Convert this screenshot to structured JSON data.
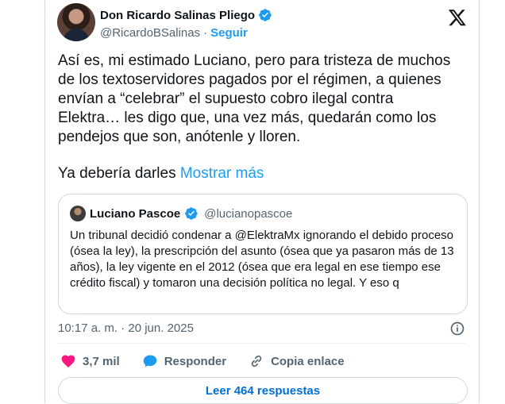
{
  "author": {
    "name": "Don Ricardo Salinas Pliego",
    "handle": "@RicardoBSalinas",
    "separator": "·",
    "follow_label": "Seguir"
  },
  "post": {
    "text": "Así es, mi estimado Luciano, pero para tristeza de muchos\nde los textoservidores pagados por el régimen, a quienes\nenvían a “celebrar” el supuesto cobro ilegal contra\nElektra… les digo que, una vez más, quedarán como los\npendejos que son, anótenle y lloren.",
    "truncated_text": "Ya debería darles",
    "show_more_label": "Mostrar más"
  },
  "quote": {
    "name": "Luciano Pascoe",
    "handle": "@lucianopascoe",
    "text": "Un tribunal decidió condenar a @ElektraMx ignorando el debido proceso (ósea la ley), la prescripción del asunto (ósea que ya pasaron más de 13 años), la ley vigente en el 2012 (ósea que era legal en ese tiempo ese crédito fiscal) y tomaron una decisión política no legal. Y eso q"
  },
  "meta": {
    "timestamp": "10:17 a. m. · 20 jun. 2025"
  },
  "actions": {
    "likes": "3,7 mil",
    "reply_label": "Responder",
    "copy_link_label": "Copia enlace"
  },
  "replies_button": "Leer 464 respuestas",
  "colors": {
    "accent": "#1d9bf0",
    "like": "#f91880",
    "verified": "#1d9bf0"
  }
}
